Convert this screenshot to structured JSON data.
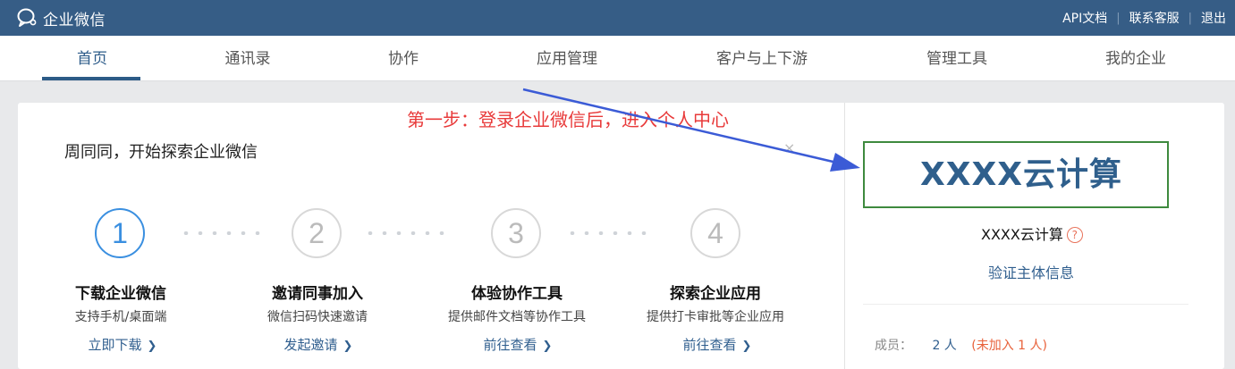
{
  "topbar": {
    "brand": "企业微信",
    "links": [
      "API文档",
      "联系客服",
      "退出"
    ]
  },
  "nav": {
    "items": [
      "首页",
      "通讯录",
      "协作",
      "应用管理",
      "客户与上下游",
      "管理工具",
      "我的企业"
    ],
    "active_index": 0
  },
  "welcome": {
    "greeting": "周同同，开始探索企业微信",
    "close_glyph": "×"
  },
  "steps": [
    {
      "number": "1",
      "title": "下载企业微信",
      "desc": "支持手机/桌面端",
      "link": "立即下载"
    },
    {
      "number": "2",
      "title": "邀请同事加入",
      "desc": "微信扫码快速邀请",
      "link": "发起邀请"
    },
    {
      "number": "3",
      "title": "体验协作工具",
      "desc": "提供邮件文档等协作工具",
      "link": "前往查看"
    },
    {
      "number": "4",
      "title": "探索企业应用",
      "desc": "提供打卡审批等企业应用",
      "link": "前往查看"
    }
  ],
  "annotation": {
    "text": "第一步：登录企业微信后，进入个人中心",
    "color": "#e83a3a"
  },
  "company": {
    "logo_text": "XXXX云计算",
    "name": "XXXX云计算",
    "help_glyph": "?",
    "verify_link": "验证主体信息",
    "members_label": "成员：",
    "members_count": "2 人",
    "members_pending": "(未加入 1 人)"
  },
  "colors": {
    "topbar": "#365d86",
    "accent": "#2c5b87",
    "step_active": "#3a8fe0",
    "highlight_box": "#3e8a3e",
    "arrow": "#3b5bd6"
  },
  "icons": {
    "brand": "chat-bubble-icon",
    "chevron": "chevron-right-icon",
    "help": "question-circle-icon"
  }
}
